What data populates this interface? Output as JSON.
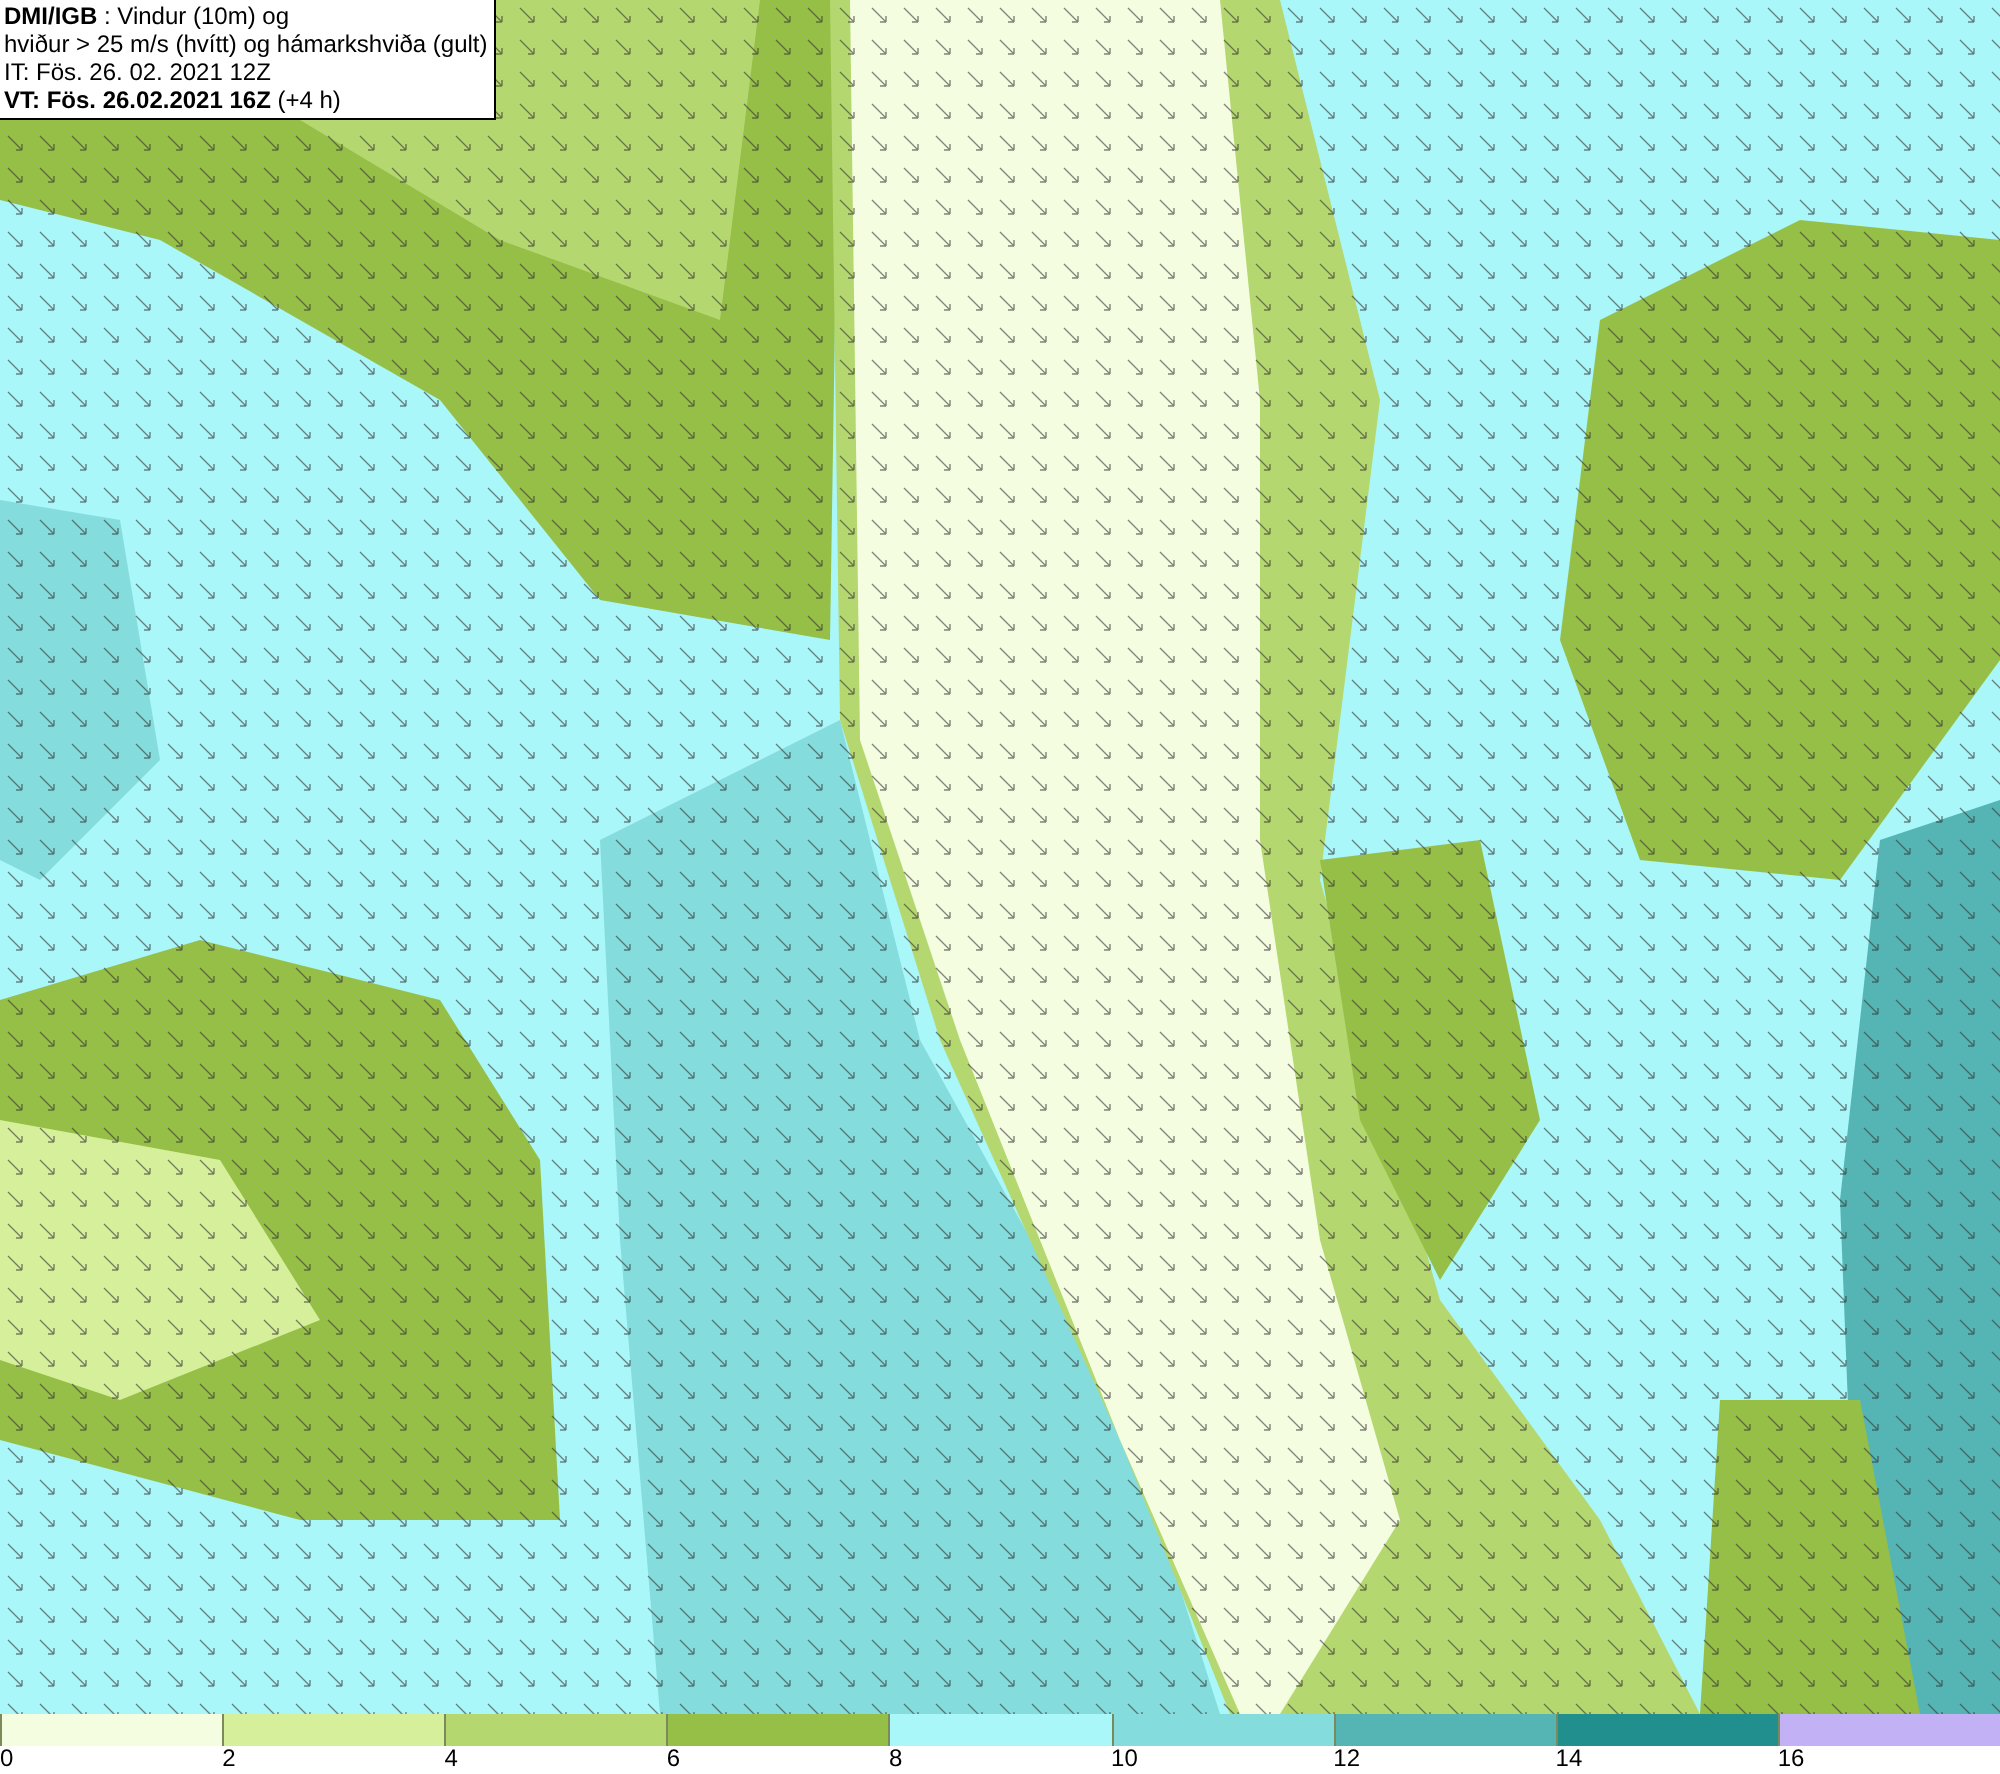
{
  "map": {
    "title_lines": [
      "**DMI/IGB** : Vindur (10m) og",
      "hviður > 25 m/s (hvítt) og hámarkshviða (gult)",
      "IT: Fös. 26. 02. 2021 12Z",
      "**VT: Fös. 26.02.2021 16Z** (+4 h)"
    ]
  },
  "legend": [
    {
      "color": "#f5fde0",
      "label": "0"
    },
    {
      "color": "#d6ef9a",
      "label": "2"
    },
    {
      "color": "#b5d770",
      "label": "4"
    },
    {
      "color": "#96bf48",
      "label": "6"
    },
    {
      "color": "#aaf7fa",
      "label": "8"
    },
    {
      "color": "#85dcdc",
      "label": "10"
    },
    {
      "color": "#55b5b5",
      "label": "12"
    },
    {
      "color": "#228f8f",
      "label": "14"
    },
    {
      "color": "#c3b1f5",
      "label": "16"
    }
  ]
}
